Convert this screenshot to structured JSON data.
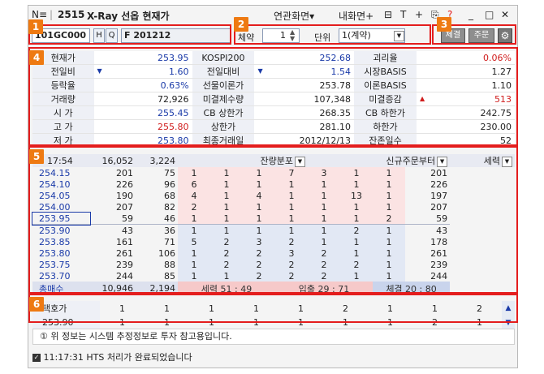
{
  "titlebar": {
    "menu_label": "N≡",
    "screen_no": "2515",
    "title": "X-Ray 선옵 현재가",
    "linked_screen": "연관화면▾",
    "my_screen": "내화면+",
    "controls": [
      "⊟",
      "T",
      "+",
      "⎘",
      "?",
      "_",
      "□",
      "✕"
    ]
  },
  "badges": [
    "1",
    "2",
    "3",
    "4",
    "5",
    "6"
  ],
  "toolbar": {
    "code": "101GC000",
    "h_btn": "H",
    "search_btn": "Q",
    "name": "F 201212",
    "multiplier_label": "체약",
    "multiplier_value": "1",
    "unit_label": "단위",
    "unit_value": "1(계약)",
    "settle_btn": "체결",
    "order_btn": "주문",
    "settings_icon": "⚙"
  },
  "info": {
    "rows": [
      [
        {
          "l": "현재가",
          "v": "253.95",
          "c": "blue"
        },
        {
          "l": "KOSPI200",
          "v": "252.68",
          "c": "blue"
        },
        {
          "l": "괴리율",
          "v": "0.06%",
          "c": "red"
        }
      ],
      [
        {
          "l": "전일비",
          "v": "1.60",
          "c": "blue",
          "ic": "down"
        },
        {
          "l": "전일대비",
          "v": "1.54",
          "c": "blue",
          "ic": "down"
        },
        {
          "l": "시장BASIS",
          "v": "1.27",
          "c": ""
        }
      ],
      [
        {
          "l": "등락율",
          "v": "0.63%",
          "c": "blue"
        },
        {
          "l": "선물이론가",
          "v": "253.78",
          "c": ""
        },
        {
          "l": "이론BASIS",
          "v": "1.10",
          "c": ""
        }
      ],
      [
        {
          "l": "거래량",
          "v": "72,926",
          "c": ""
        },
        {
          "l": "미결제수량",
          "v": "107,348",
          "c": ""
        },
        {
          "l": "미결증감",
          "v": "513",
          "c": "red",
          "ic": "up"
        }
      ],
      [
        {
          "l": "시  가",
          "v": "255.45",
          "c": "blue"
        },
        {
          "l": "CB 상한가",
          "v": "268.35",
          "c": ""
        },
        {
          "l": "CB 하한가",
          "v": "242.75",
          "c": ""
        }
      ],
      [
        {
          "l": "고  가",
          "v": "255.80",
          "c": "red"
        },
        {
          "l": "상한가",
          "v": "281.10",
          "c": ""
        },
        {
          "l": "하한가",
          "v": "230.00",
          "c": ""
        }
      ],
      [
        {
          "l": "저  가",
          "v": "253.80",
          "c": "blue"
        },
        {
          "l": "최종거래일",
          "v": "2012/12/13",
          "c": ""
        },
        {
          "l": "잔존일수",
          "v": "52",
          "c": ""
        }
      ]
    ]
  },
  "orderbook": {
    "time": "17:54",
    "total_left": "16,052",
    "total_count": "3,224",
    "dist_label": "잔량분포",
    "new_order_label": "신규주문부터",
    "power_label": "세력",
    "asks": [
      {
        "p": "254.15",
        "q": "201",
        "n": "75",
        "cells": [
          "1",
          "1",
          "1",
          "7",
          "3",
          "1",
          "1"
        ],
        "s": "201"
      },
      {
        "p": "254.10",
        "q": "226",
        "n": "96",
        "cells": [
          "6",
          "1",
          "1",
          "1",
          "1",
          "1",
          "1"
        ],
        "s": "226"
      },
      {
        "p": "254.05",
        "q": "190",
        "n": "68",
        "cells": [
          "4",
          "1",
          "4",
          "1",
          "1",
          "13",
          "1"
        ],
        "s": "197"
      },
      {
        "p": "254.00",
        "q": "207",
        "n": "82",
        "cells": [
          "2",
          "1",
          "1",
          "1",
          "1",
          "1",
          "1"
        ],
        "s": "207"
      },
      {
        "p": "253.95",
        "q": "59",
        "n": "46",
        "cells": [
          "1",
          "1",
          "1",
          "1",
          "1",
          "1",
          "2"
        ],
        "s": "59"
      }
    ],
    "bids": [
      {
        "p": "253.90",
        "q": "43",
        "n": "36",
        "cells": [
          "1",
          "1",
          "1",
          "1",
          "1",
          "2",
          "1"
        ],
        "s": "43"
      },
      {
        "p": "253.85",
        "q": "161",
        "n": "71",
        "cells": [
          "5",
          "2",
          "3",
          "2",
          "1",
          "1",
          "1"
        ],
        "s": "178"
      },
      {
        "p": "253.80",
        "q": "261",
        "n": "106",
        "cells": [
          "1",
          "2",
          "2",
          "3",
          "2",
          "1",
          "1"
        ],
        "s": "261"
      },
      {
        "p": "253.75",
        "q": "239",
        "n": "88",
        "cells": [
          "1",
          "2",
          "2",
          "2",
          "2",
          "2",
          "1"
        ],
        "s": "239"
      },
      {
        "p": "253.70",
        "q": "244",
        "n": "85",
        "cells": [
          "1",
          "1",
          "2",
          "2",
          "2",
          "1",
          "1"
        ],
        "s": "244"
      }
    ],
    "total_bid_label": "총매수",
    "total_bid_qty": "10,946",
    "total_bid_count": "2,194",
    "power_ratio": "세력  51 : 49",
    "inout_ratio": "입출  29 : 71",
    "settle_ratio": "체결  20 : 80"
  },
  "expected": {
    "label": "택호가",
    "price": "253.90",
    "row1": [
      "1",
      "1",
      "1",
      "1",
      "1",
      "2",
      "1",
      "1",
      "2"
    ],
    "row2": [
      "1",
      "1",
      "1",
      "1",
      "1",
      "1",
      "1",
      "2",
      "1"
    ]
  },
  "notice": "① 위 정보는 시스템 추정정보로 투자 참고용입니다.",
  "status": {
    "time": "11:17:31",
    "message": "HTS 처리가 완료되었습니다"
  }
}
